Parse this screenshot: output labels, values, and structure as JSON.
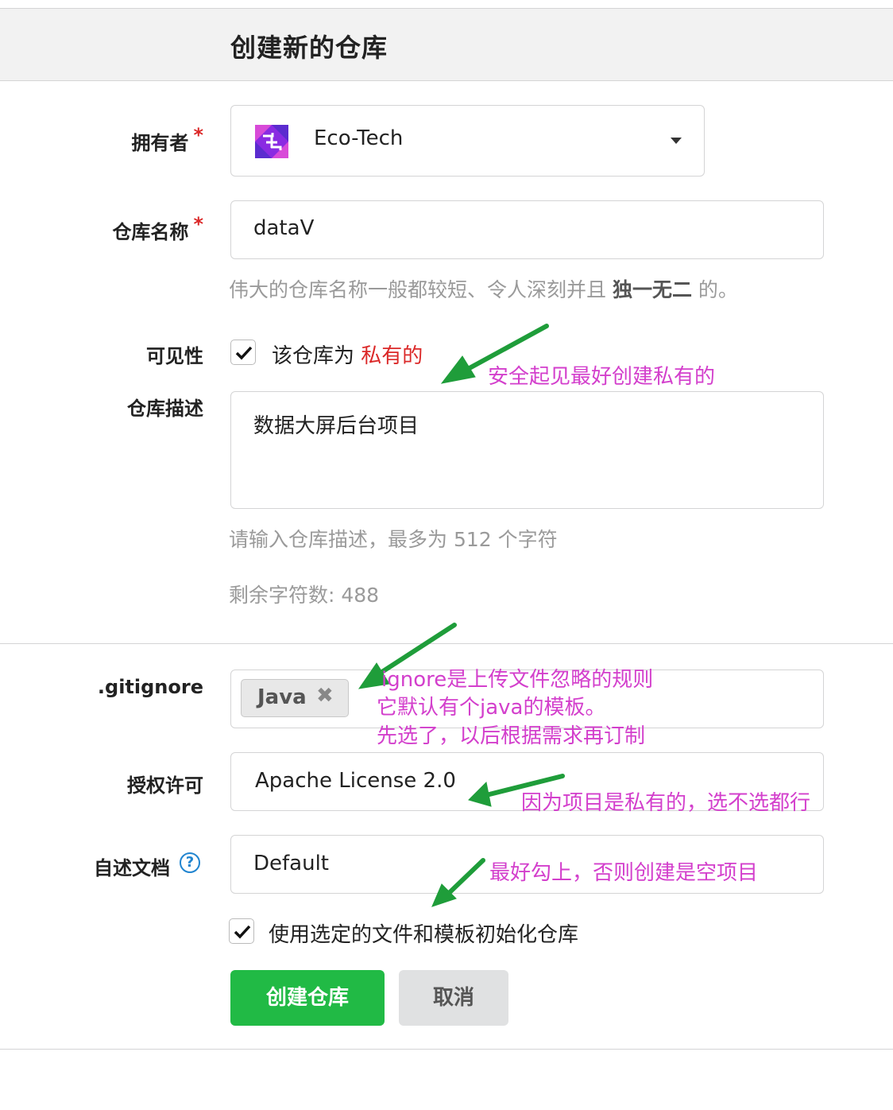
{
  "header": {
    "title": "创建新的仓库"
  },
  "owner": {
    "label": "拥有者",
    "required_mark": "*",
    "value": "Eco-Tech",
    "logo_icon": "eco-tech-logo-icon"
  },
  "repo_name": {
    "label": "仓库名称",
    "required_mark": "*",
    "value": "dataV",
    "help_prefix": "伟大的仓库名称一般都较短、令人深刻并且 ",
    "help_bold": "独一无二",
    "help_suffix": " 的。"
  },
  "visibility": {
    "label": "可见性",
    "checked": true,
    "text_prefix": "该仓库为 ",
    "text_private": "私有的"
  },
  "description": {
    "label": "仓库描述",
    "value": "数据大屏后台项目",
    "help": "请输入仓库描述，最多为 512 个字符",
    "remaining": "剩余字符数: 488"
  },
  "gitignore": {
    "label": ".gitignore",
    "tags": [
      "Java"
    ],
    "remove_icon": "✖"
  },
  "license": {
    "label": "授权许可",
    "value": "Apache License 2.0"
  },
  "readme": {
    "label": "自述文档",
    "help_icon": "?",
    "value": "Default"
  },
  "auto_init": {
    "checked": true,
    "text": "使用选定的文件和模板初始化仓库"
  },
  "actions": {
    "create": "创建仓库",
    "cancel": "取消"
  },
  "annotations": {
    "private": "安全起见最好创建私有的",
    "gitignore_1": "ignore是上传文件忽略的规则",
    "gitignore_2": "它默认有个java的模板。",
    "gitignore_3": "先选了，以后根据需求再订制",
    "license": "因为项目是私有的，选不选都行",
    "init": "最好勾上，否则创建是空项目",
    "color": "#d33fcc",
    "arrow_color": "#1f9d3a"
  }
}
